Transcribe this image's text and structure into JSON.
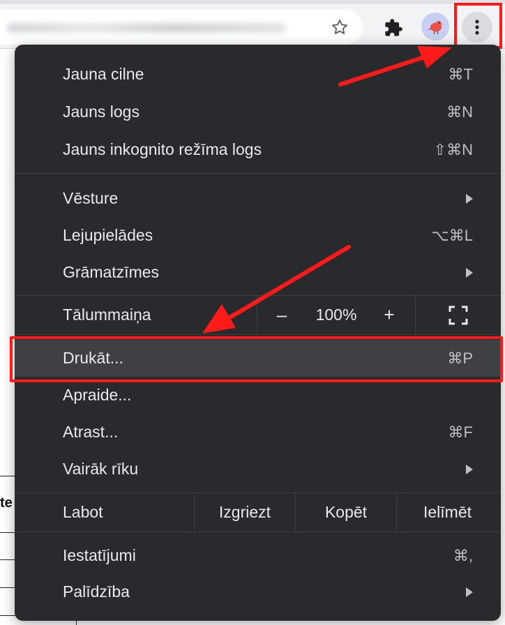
{
  "toolbar": {
    "icons": [
      "star-icon",
      "puzzle-icon",
      "avatar",
      "kebab-menu-icon"
    ]
  },
  "page_behind": {
    "partial_text": "te"
  },
  "menu": {
    "group1": [
      {
        "label": "Jauna cilne",
        "shortcut": "⌘T"
      },
      {
        "label": "Jauns logs",
        "shortcut": "⌘N"
      },
      {
        "label": "Jauns inkognito režīma logs",
        "shortcut": "⇧⌘N"
      }
    ],
    "group2": [
      {
        "label": "Vēsture",
        "has_submenu": true
      },
      {
        "label": "Lejupielādes",
        "shortcut": "⌥⌘L"
      },
      {
        "label": "Grāmatzīmes",
        "has_submenu": true
      }
    ],
    "zoom": {
      "label": "Tālummaiņa",
      "minus": "–",
      "value": "100%",
      "plus": "+"
    },
    "group3": [
      {
        "label": "Drukāt...",
        "shortcut": "⌘P",
        "highlighted": true
      },
      {
        "label": "Apraide..."
      },
      {
        "label": "Atrast...",
        "shortcut": "⌘F"
      },
      {
        "label": "Vairāk rīku",
        "has_submenu": true
      }
    ],
    "edit": {
      "label": "Labot",
      "cut": "Izgriezt",
      "copy": "Kopēt",
      "paste": "Ielīmēt"
    },
    "group4": [
      {
        "label": "Iestatījumi",
        "shortcut": "⌘,"
      },
      {
        "label": "Palīdzība",
        "has_submenu": true
      }
    ]
  },
  "colors": {
    "menu_bg": "#292a2d",
    "menu_highlight": "#3f4043",
    "annotation_red": "#ff1a1a"
  }
}
